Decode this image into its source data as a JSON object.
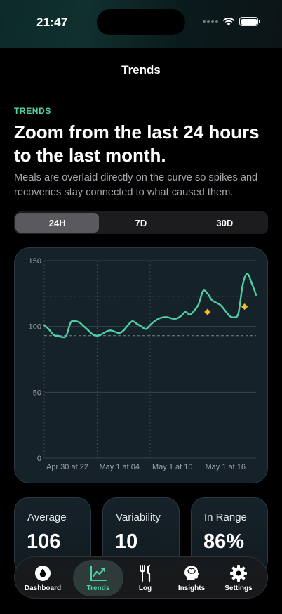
{
  "status_bar": {
    "time": "21:47"
  },
  "nav": {
    "title": "Trends"
  },
  "intro": {
    "eyebrow": "TRENDS",
    "headline": "Zoom from the last 24 hours to the last month.",
    "subtext": "Meals are overlaid directly on the curve so spikes and recoveries stay connected to what caused them."
  },
  "range_selector": {
    "options": [
      "24H",
      "7D",
      "30D"
    ],
    "selected": "24H"
  },
  "chart_data": {
    "type": "line",
    "title": "",
    "xlabel": "",
    "ylabel": "",
    "ylim": [
      0,
      150
    ],
    "y_ticks": [
      0,
      50,
      100,
      150
    ],
    "x_tick_labels": [
      "Apr 30 at 22",
      "May 1 at 04",
      "May 1 at 10",
      "May 1 at 16"
    ],
    "target_range": [
      93,
      123
    ],
    "x_hours": [
      0,
      0.5,
      1,
      1.3,
      1.6,
      2,
      2.5,
      3,
      3.5,
      4,
      4.5,
      5,
      5.5,
      6,
      6.5,
      7,
      7.5,
      8,
      8.5,
      9,
      9.5,
      10,
      10.5,
      11,
      11.5,
      12,
      12.5,
      13,
      13.5,
      14,
      14.5,
      15,
      15.5,
      16,
      16.5,
      17,
      17.5,
      18,
      18.5,
      19,
      19.5,
      20,
      20.5,
      21,
      21.5,
      22,
      22.5,
      23,
      23.5,
      24
    ],
    "values": [
      101,
      98,
      94,
      93,
      93,
      92,
      93,
      103,
      104,
      103,
      100,
      97,
      94,
      93,
      94,
      96,
      97,
      96,
      95,
      97,
      101,
      104,
      102,
      100,
      98,
      101,
      104,
      106,
      107,
      107,
      106,
      106,
      108,
      111,
      109,
      112,
      117,
      127,
      125,
      120,
      118,
      116,
      112,
      108,
      107,
      110,
      132,
      140,
      133,
      124
    ],
    "meal_markers": [
      {
        "x_hour": 18.5,
        "value": 111
      },
      {
        "x_hour": 22.7,
        "value": 115
      }
    ],
    "grid": true,
    "line_color": "#4fd1a5",
    "marker_color": "#f5b731"
  },
  "stats": [
    {
      "label": "Average",
      "value": "106"
    },
    {
      "label": "Variability",
      "value": "10"
    },
    {
      "label": "In Range",
      "value": "86%"
    }
  ],
  "tab_bar": {
    "items": [
      {
        "label": "Dashboard",
        "icon": "drop-icon"
      },
      {
        "label": "Trends",
        "icon": "trend-chart-icon"
      },
      {
        "label": "Log",
        "icon": "fork-knife-icon"
      },
      {
        "label": "Insights",
        "icon": "brain-head-icon"
      },
      {
        "label": "Settings",
        "icon": "gear-icon"
      }
    ],
    "active": "Trends"
  },
  "colors": {
    "accent": "#4fd1a5",
    "meal_marker": "#f5b731",
    "card_bg": "#16222a"
  }
}
